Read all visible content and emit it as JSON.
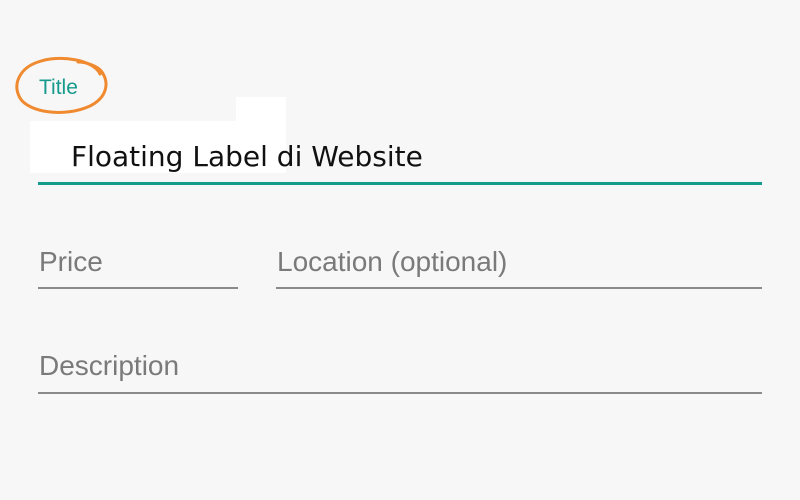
{
  "form": {
    "title": {
      "label": "Title",
      "value": "Floating Label di Website"
    },
    "price": {
      "placeholder": "Price"
    },
    "location": {
      "placeholder": "Location (optional)"
    },
    "description": {
      "placeholder": "Description"
    }
  },
  "colors": {
    "accent": "#159a8c",
    "highlight": "#f08a30",
    "underline_inactive": "#8a8a8a",
    "placeholder_text": "#7a7a7a",
    "background": "#f7f7f7"
  }
}
